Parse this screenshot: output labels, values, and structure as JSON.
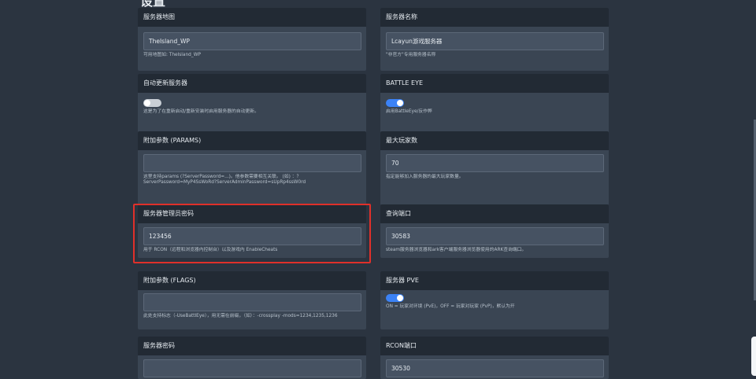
{
  "section": {
    "title": "设置"
  },
  "cards": {
    "server_map": {
      "label": "服务器地图",
      "value": "TheIsland_WP",
      "hint": "可用地图如: TheIsland_WP"
    },
    "server_name": {
      "label": "服务器名称",
      "value": "Lcayun游戏服务器",
      "hint": "\"非官方\"专用服务器名称"
    },
    "auto_update": {
      "label": "自动更新服务器",
      "enabled": false,
      "hint": "这是为了在重新启动/重新安装时启用服务器的自动更新。"
    },
    "battle_eye": {
      "label": "BATTLE EYE",
      "enabled": true,
      "hint": "启用BattleEye/反作弊"
    },
    "extra_params": {
      "label": "附加参数 (PARAMS)",
      "value": "",
      "hint": "这里支持params (?ServerPassword=...)。他参数需要相互关联。 (如) ：？ServerPassword=MyP4SsWoRd?ServerAdminPassword=sUpRp4ssW0rd"
    },
    "max_players": {
      "label": "最大玩家数",
      "value": "70",
      "hint": "指定能够加入服务器的最大玩家数量。"
    },
    "admin_password": {
      "label": "服务器管理员密码",
      "value": "123456",
      "hint": "用于 RCON（远程和浏览器内控制台）以及游戏内 EnableCheats"
    },
    "query_port": {
      "label": "查询端口",
      "value": "30583",
      "hint": "steam服务器浏览器和ark客户端服务器浏览器使用的ARK查询端口。"
    },
    "extra_flags": {
      "label": "附加参数 (FLAGS)",
      "value": "",
      "hint": "此处支持标志（-UseBattlEye），用无需在前缀，（如）：-crossplay -mods=1234,1235,1236"
    },
    "server_pve": {
      "label": "服务器 PVE",
      "enabled": true,
      "hint": "ON = 玩家对环境 (PvE)，OFF = 玩家对玩家 (PvP)，默认为开"
    },
    "server_password": {
      "label": "服务器密码",
      "value": ""
    },
    "rcon_port": {
      "label": "RCON端口",
      "value": "30530"
    }
  }
}
